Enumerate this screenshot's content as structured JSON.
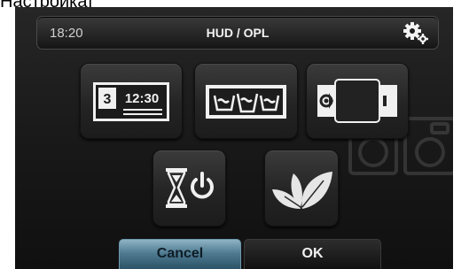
{
  "caption": "Настройка]",
  "status": {
    "time": "18:20",
    "title": "HUD / OPL",
    "settings_icon": "gears-icon"
  },
  "tiles": {
    "date_time": {
      "icon": "date-time-icon",
      "day": "3",
      "time": "12:30"
    },
    "wash_programs": {
      "icon": "wash-programs-icon"
    },
    "machine_door": {
      "icon": "machine-door-icon"
    },
    "delay_timer": {
      "icon": "hourglass-power-icon"
    },
    "eco_mode": {
      "icon": "leaf-icon"
    }
  },
  "buttons": {
    "cancel": "Cancel",
    "ok": "OK"
  },
  "colors": {
    "cancel_accent": "#4e7a90",
    "background": "#181818"
  }
}
